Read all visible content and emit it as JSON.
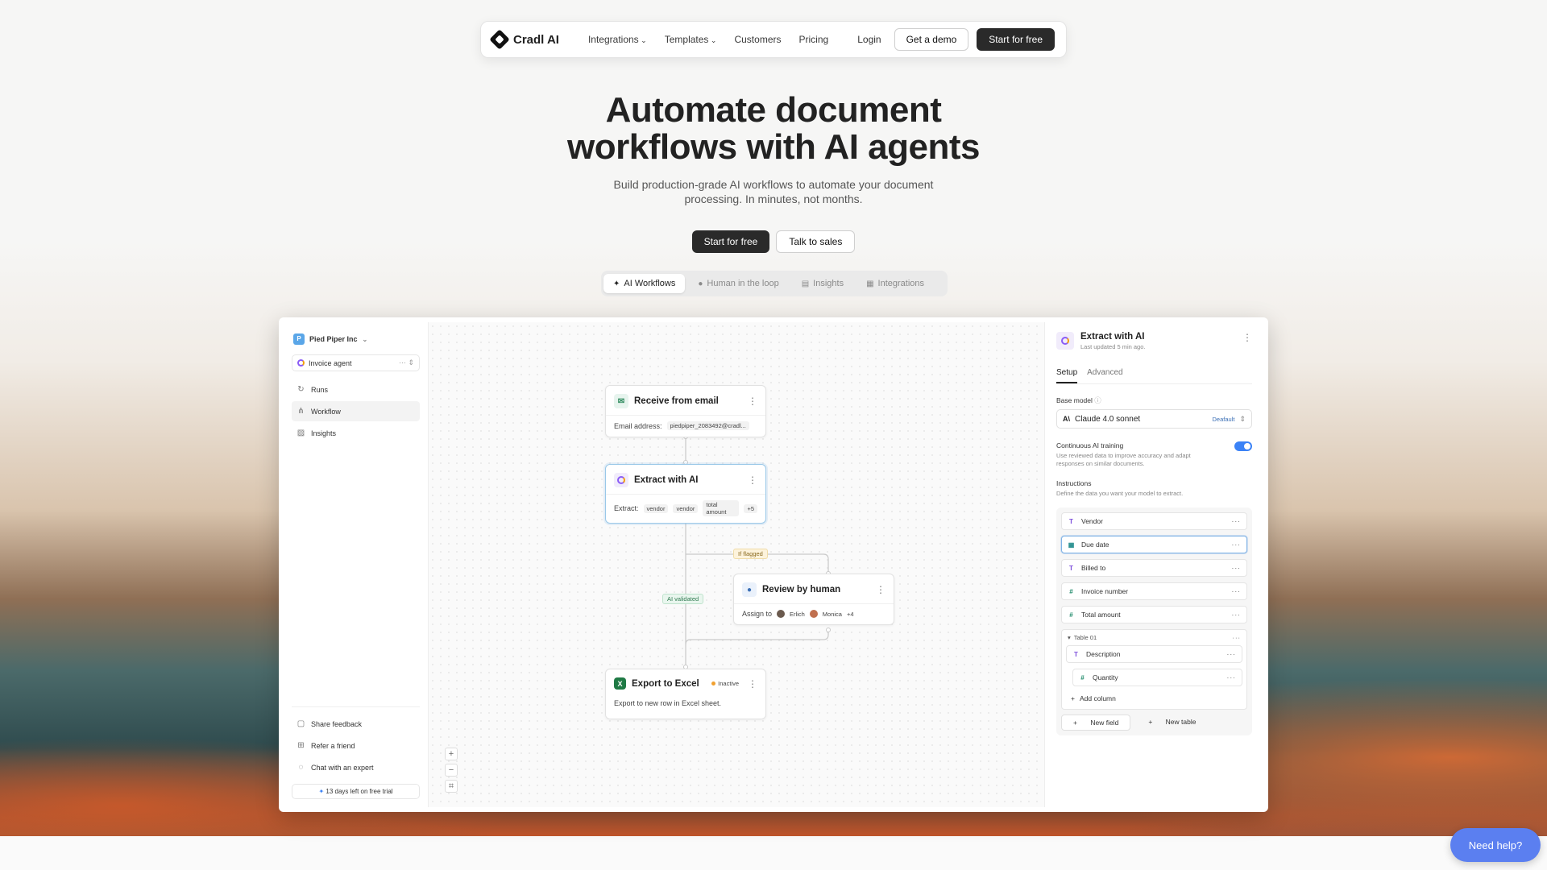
{
  "nav": {
    "brand": "Cradl AI",
    "links": [
      "Integrations",
      "Templates",
      "Customers",
      "Pricing"
    ],
    "login": "Login",
    "demo": "Get a demo",
    "start": "Start for free"
  },
  "hero": {
    "title_line1": "Automate document",
    "title_line2": "workflows with AI agents",
    "subtitle_line1": "Build production-grade AI workflows to automate your document",
    "subtitle_line2": "processing. In minutes, not months.",
    "cta_primary": "Start for free",
    "cta_secondary": "Talk to sales"
  },
  "tabs": [
    "AI Workflows",
    "Human in the loop",
    "Insights",
    "Integrations"
  ],
  "sidebar": {
    "org": "Pied Piper Inc",
    "org_initial": "P",
    "agent": "Invoice agent",
    "items": [
      "Runs",
      "Workflow",
      "Insights"
    ],
    "bottom": [
      "Share feedback",
      "Refer a friend",
      "Chat with an expert"
    ],
    "trial": "13 days left on free trial"
  },
  "canvas": {
    "receive": {
      "title": "Receive from email",
      "label": "Email address:",
      "value": "piedpiper_2083492@cradl..."
    },
    "extract": {
      "title": "Extract with AI",
      "label": "Extract:",
      "chips": [
        "vendor",
        "vendor",
        "total amount",
        "+5"
      ]
    },
    "flagged": "If flagged",
    "validated": "AI validated",
    "review": {
      "title": "Review by human",
      "label": "Assign to",
      "people": [
        "Erlich",
        "Monica"
      ],
      "more": "+4"
    },
    "export": {
      "title": "Export to Excel",
      "status": "Inactive",
      "desc": "Export to new row in Excel sheet."
    },
    "zoom": [
      "+",
      "−",
      "⌗"
    ]
  },
  "panel": {
    "title": "Extract with AI",
    "subtitle": "Last updated 5 min ago.",
    "tabs": [
      "Setup",
      "Advanced"
    ],
    "base_model_label": "Base model",
    "base_model": "Claude 4.0 sonnet",
    "base_model_tag": "Deafault",
    "training_title": "Continuous AI training",
    "training_desc": "Use reviewed data to improve accuracy and adapt responses on similar documents.",
    "instructions_title": "Instructions",
    "instructions_desc": "Define the data you want your model to extract.",
    "fields": [
      {
        "type": "T",
        "name": "Vendor"
      },
      {
        "type": "▦",
        "name": "Due date"
      },
      {
        "type": "T",
        "name": "Billed to"
      },
      {
        "type": "#",
        "name": "Invoice number"
      },
      {
        "type": "#",
        "name": "Total amount"
      }
    ],
    "table_name": "Table 01",
    "table_fields": [
      {
        "type": "T",
        "name": "Description"
      },
      {
        "type": "#",
        "name": "Quantity"
      }
    ],
    "add_column": "Add column",
    "new_field": "New field",
    "new_table": "New table"
  },
  "help": "Need help?"
}
